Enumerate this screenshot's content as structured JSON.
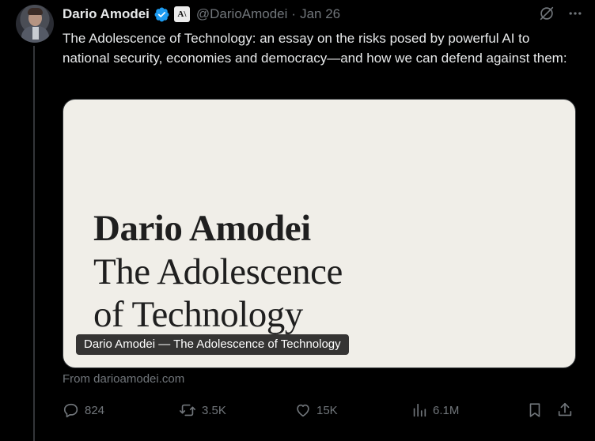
{
  "tweet": {
    "author_name": "Dario Amodei",
    "handle": "@DarioAmodei",
    "separator": "·",
    "date": "Jan 26",
    "org_badge_text": "A\\",
    "text": "The Adolescence of Technology: an essay on the risks posed by powerful AI to national security, economies and democracy—and how we can defend against them:"
  },
  "card": {
    "title_line1": "Dario Amodei",
    "title_line2": "The Adolescence",
    "title_line3": "of Technology",
    "caption": "Dario Amodei — The Adolescence of Technology",
    "source": "From darioamodei.com",
    "background": "#f0eee8"
  },
  "actions": {
    "reply_count": "824",
    "retweet_count": "3.5K",
    "like_count": "15K",
    "views_count": "6.1M"
  },
  "colors": {
    "background": "#000000",
    "text": "#e7e9ea",
    "muted": "#71767b",
    "verified": "#1d9bf0"
  },
  "icons": [
    "grok-icon",
    "more-icon",
    "verified-icon",
    "reply-icon",
    "retweet-icon",
    "like-icon",
    "views-icon",
    "bookmark-icon",
    "share-icon"
  ]
}
